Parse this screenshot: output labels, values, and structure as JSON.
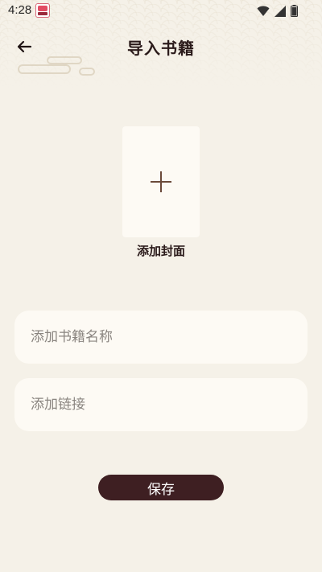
{
  "status_bar": {
    "time": "4:28",
    "icons": [
      "app-notification-icon",
      "wifi-icon",
      "signal-icon",
      "battery-icon"
    ]
  },
  "header": {
    "back_icon": "arrow-left-icon",
    "title": "导入书籍"
  },
  "cover": {
    "icon": "plus-icon",
    "label": "添加封面"
  },
  "form": {
    "book_name_placeholder": "添加书籍名称",
    "book_name_value": "",
    "link_placeholder": "添加链接",
    "link_value": ""
  },
  "actions": {
    "save_label": "保存"
  },
  "colors": {
    "background": "#f5f1e8",
    "card": "#fdfaf4",
    "primary": "#3e1f22",
    "plus": "#6b4a3a"
  }
}
